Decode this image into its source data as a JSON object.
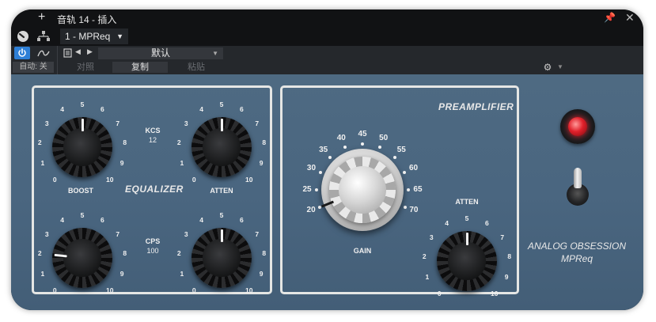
{
  "window": {
    "title": "音轨 14 - 插入",
    "plus_label": "+",
    "pin_icon": "pin-icon",
    "close_icon": "close-icon"
  },
  "toolbar": {
    "insert_name": "1 - MPReq",
    "preset_name": "默认",
    "auto_label": "自动: 关",
    "compare_label": "对照",
    "copy_label": "复制",
    "paste_label": "粘贴",
    "accent_color": "#2e7fd6"
  },
  "plugin": {
    "equalizer": {
      "title": "EQUALIZER",
      "boost_label": "BOOST",
      "atten_label": "ATTEN",
      "kcs_label": "KCS",
      "kcs_value": "12",
      "cps_label": "CPS",
      "cps_value": "100",
      "knobs": [
        {
          "name": "boost-kcs",
          "value": 0.5
        },
        {
          "name": "atten-kcs",
          "value": 0.5
        },
        {
          "name": "boost-cps",
          "value": 0.2
        },
        {
          "name": "atten-cps",
          "value": 0.5
        }
      ],
      "scale": [
        "0",
        "1",
        "2",
        "3",
        "4",
        "5",
        "6",
        "7",
        "8",
        "9",
        "10"
      ]
    },
    "preamplifier": {
      "title": "PREAMPLIFIER",
      "gain_label": "GAIN",
      "gain_scale": [
        "20",
        "25",
        "30",
        "35",
        "40",
        "45",
        "50",
        "55",
        "60",
        "65",
        "70"
      ],
      "gain_value": "20",
      "atten_label": "ATTEN",
      "atten_value": "5",
      "atten_scale": [
        "0",
        "1",
        "2",
        "3",
        "4",
        "5",
        "6",
        "7",
        "8",
        "9",
        "10"
      ]
    },
    "brand_line1": "ANALOG OBSESSION",
    "brand_line2": "MPReq",
    "lamp_color": "#e0202a",
    "panel_color": "#4a6680"
  }
}
